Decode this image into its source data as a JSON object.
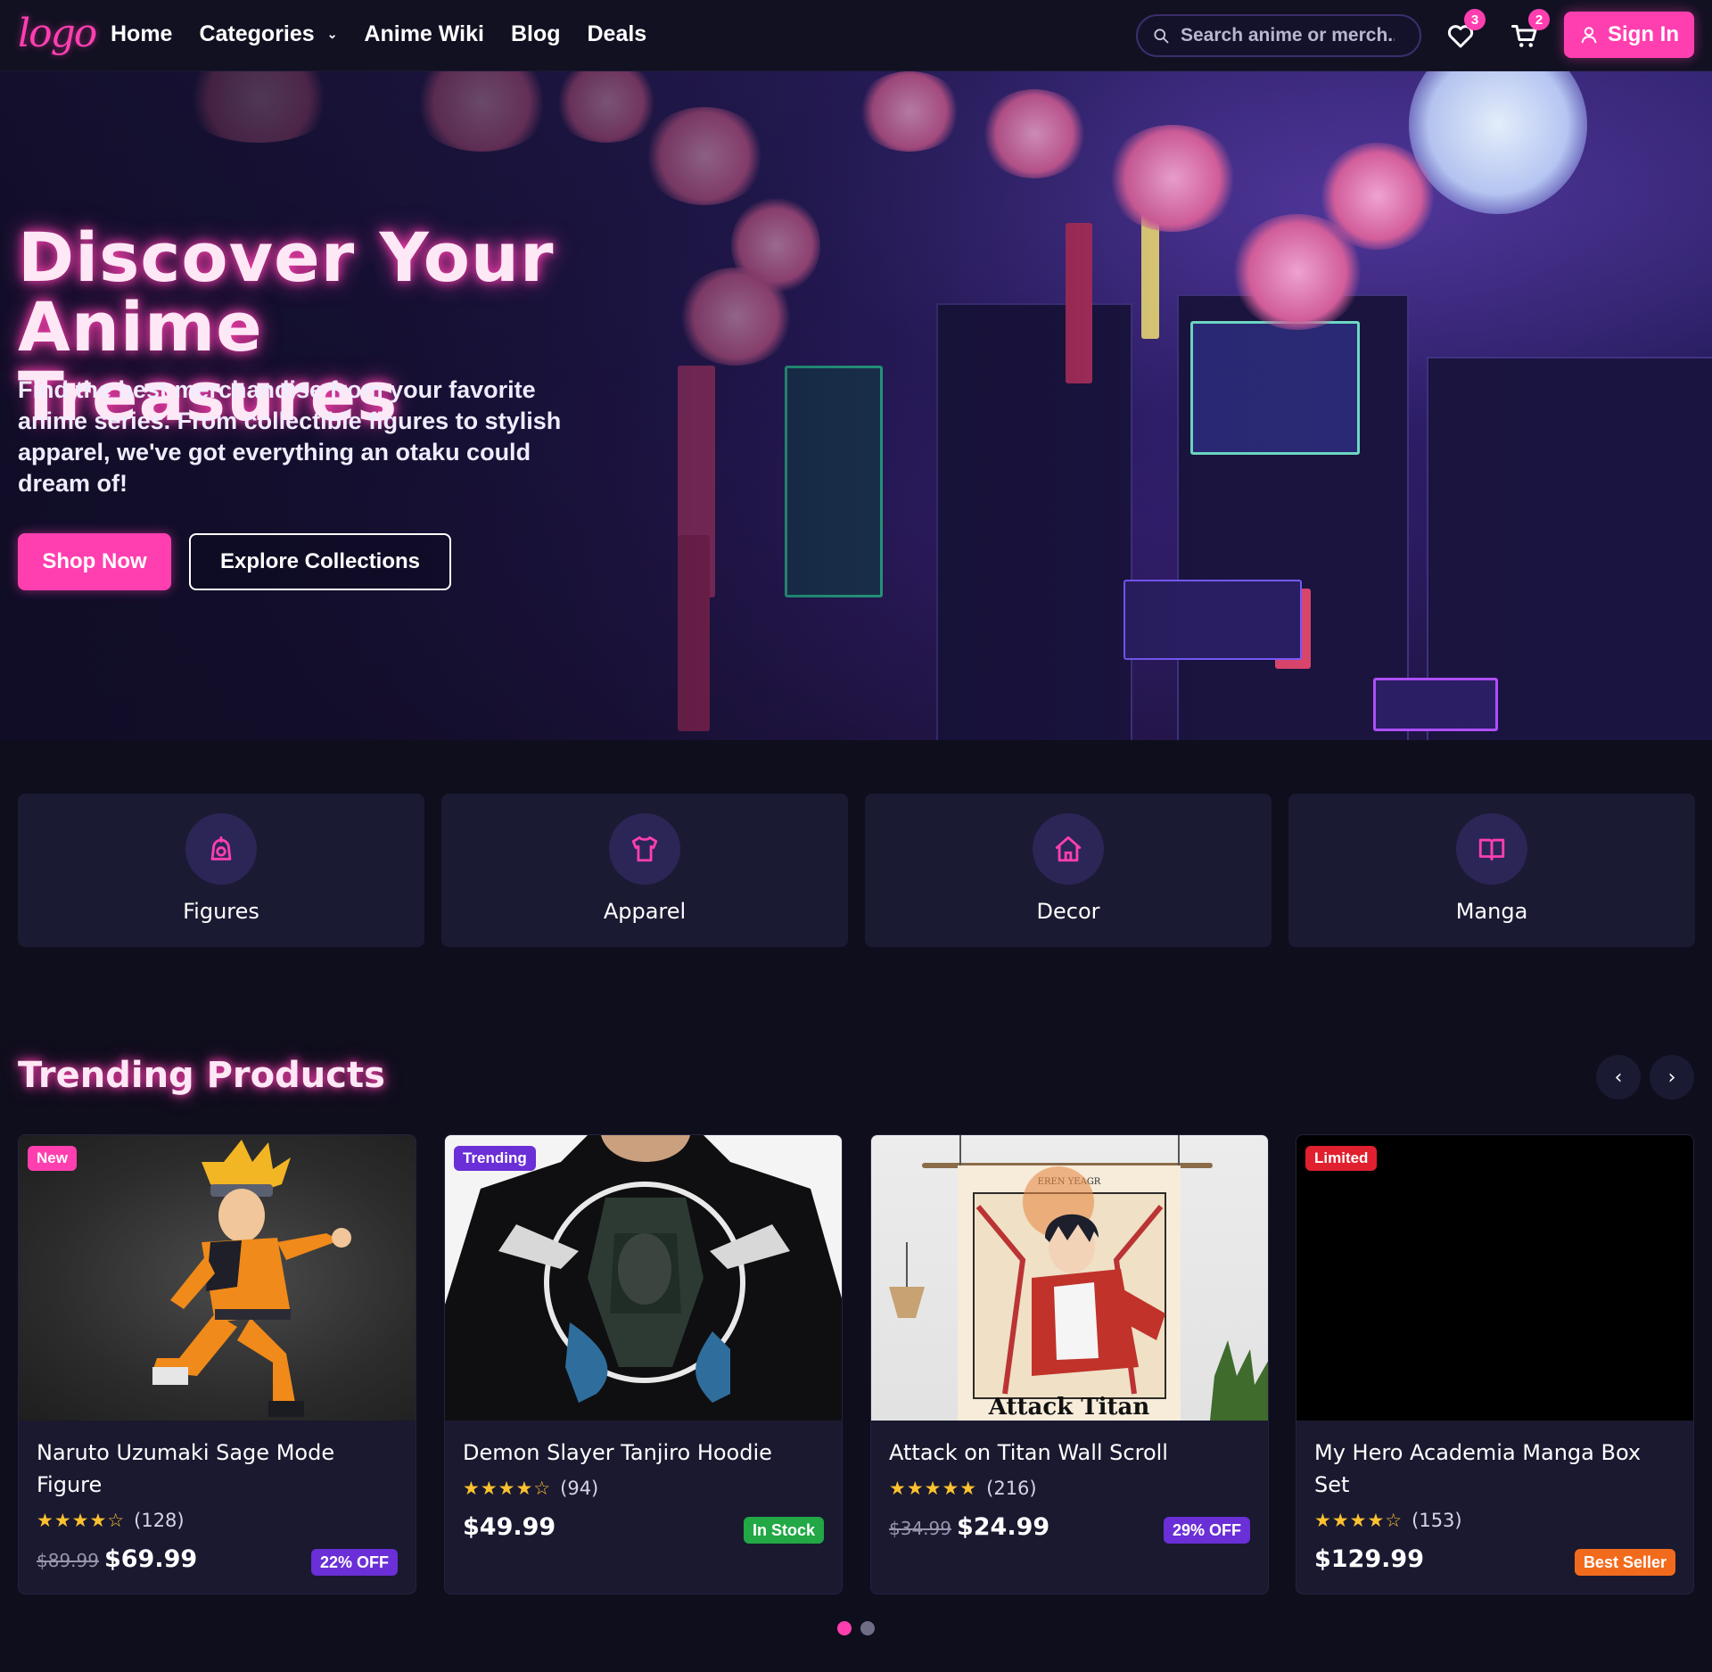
{
  "nav": {
    "logo": "logo",
    "links": [
      "Home",
      "Categories",
      "Anime Wiki",
      "Blog",
      "Deals"
    ],
    "search_placeholder": "Search anime or merch...",
    "wishlist_count": "3",
    "cart_count": "2",
    "signin_label": "Sign In"
  },
  "hero": {
    "title_line1": "Discover Your Anime",
    "title_line2": "Treasures",
    "subtitle": "Find the best merchandise from your favorite anime series. From collectible figures to stylish apparel, we've got everything an otaku could dream of!",
    "shop_label": "Shop Now",
    "explore_label": "Explore Collections"
  },
  "categories": [
    {
      "label": "Figures",
      "icon": "figure-icon"
    },
    {
      "label": "Apparel",
      "icon": "shirt-icon"
    },
    {
      "label": "Decor",
      "icon": "home-icon"
    },
    {
      "label": "Manga",
      "icon": "book-icon"
    }
  ],
  "trending": {
    "title": "Trending Products",
    "prev": "‹",
    "next": "›",
    "products": [
      {
        "tag": "New",
        "name": "Naruto Uzumaki Sage Mode Figure",
        "stars": "★★★★☆",
        "rating": 4.5,
        "reviews": "(128)",
        "old_price": "$89.99",
        "price": "$69.99",
        "pill": "22% OFF"
      },
      {
        "tag": "Trending",
        "name": "Demon Slayer Tanjiro Hoodie",
        "stars": "★★★★☆",
        "rating": 4.0,
        "reviews": "(94)",
        "old_price": "",
        "price": "$49.99",
        "pill": "In Stock"
      },
      {
        "tag": "",
        "name": "Attack on Titan Wall Scroll",
        "stars": "★★★★★",
        "rating": 5.0,
        "reviews": "(216)",
        "old_price": "$34.99",
        "price": "$24.99",
        "pill": "29% OFF",
        "banner_text": "EREN YEAGR",
        "banner_footer": "Attack Titan"
      },
      {
        "tag": "Limited",
        "name": "My Hero Academia Manga Box Set",
        "stars": "★★★★☆",
        "rating": 4.5,
        "reviews": "(153)",
        "old_price": "",
        "price": "$129.99",
        "pill": "Best Seller"
      }
    ]
  },
  "colors": {
    "accent": "#ff3fb0",
    "purple": "#6a2fd6",
    "green": "#22a845",
    "red": "#e0202e",
    "orange": "#f26b1d",
    "background": "#0f0e1d",
    "card": "#1a1930"
  }
}
